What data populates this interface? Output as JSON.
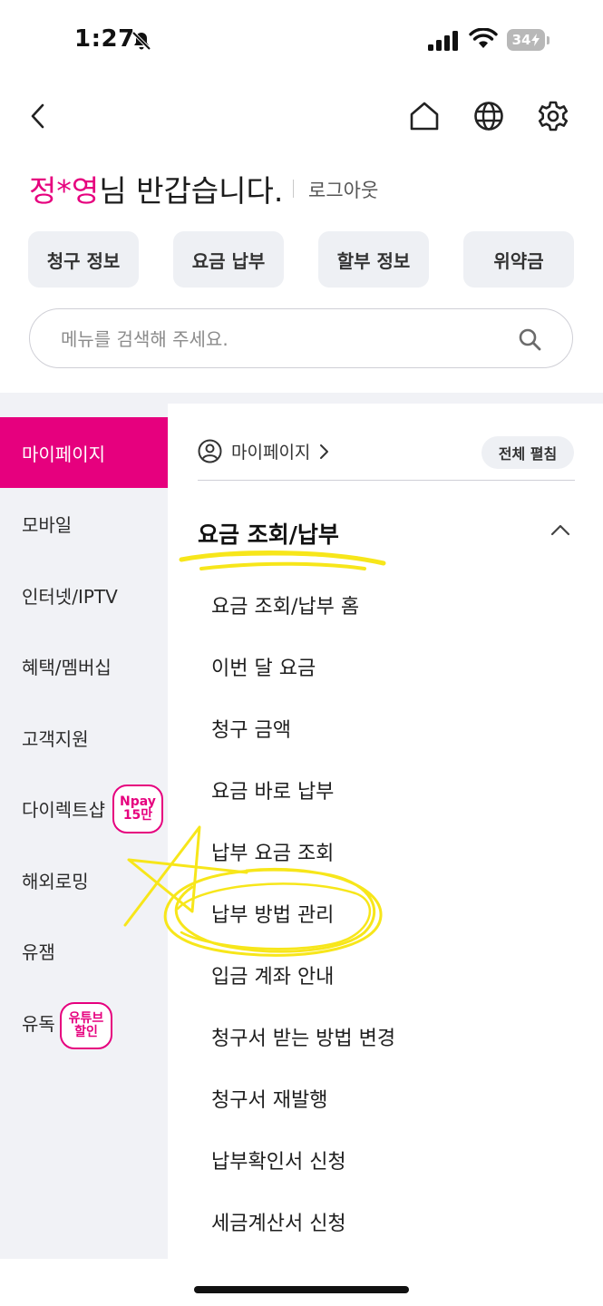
{
  "status_bar": {
    "time": "1:27",
    "battery": "34"
  },
  "greeting": {
    "name": "정*영",
    "suffix": "님 반갑습니다.",
    "logout": "로그아웃"
  },
  "quick_buttons": [
    "청구 정보",
    "요금 납부",
    "할부 정보",
    "위약금"
  ],
  "search": {
    "placeholder": "메뉴를 검색해 주세요."
  },
  "sidebar": {
    "items": [
      {
        "label": "마이페이지"
      },
      {
        "label": "모바일"
      },
      {
        "label": "인터넷/IPTV"
      },
      {
        "label": "혜택/멤버십"
      },
      {
        "label": "고객지원"
      },
      {
        "label": "다이렉트샵",
        "badge": [
          "Npay",
          "15만"
        ]
      },
      {
        "label": "해외로밍"
      },
      {
        "label": "유잼"
      },
      {
        "label": "유독",
        "badge": [
          "유튜브",
          "할인"
        ]
      }
    ]
  },
  "content": {
    "breadcrumb": "마이페이지",
    "expand_all": "전체 펼침",
    "section_title": "요금 조회/납부",
    "menu": [
      "요금 조회/납부 홈",
      "이번 달 요금",
      "청구 금액",
      "요금 바로 납부",
      "납부 요금 조회",
      "납부 방법 관리",
      "입금 계좌 안내",
      "청구서 받는 방법 변경",
      "청구서 재발행",
      "납부확인서 신청",
      "세금계산서 신청"
    ]
  },
  "colors": {
    "accent": "#e6007e",
    "highlight": "#f7e61a",
    "panel": "#f1f2f6"
  }
}
